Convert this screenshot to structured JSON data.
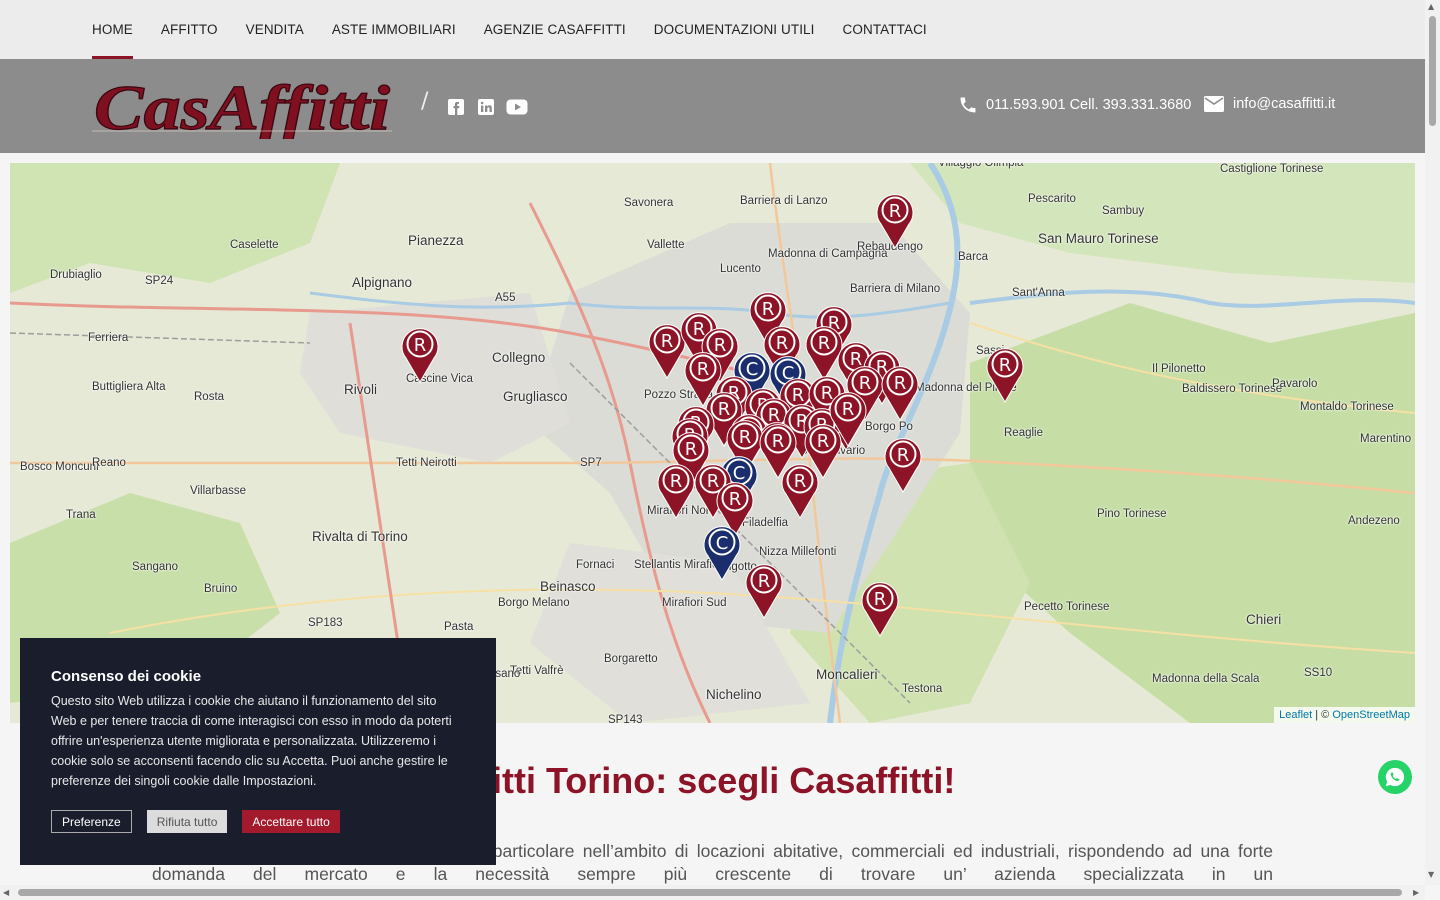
{
  "nav": {
    "items": [
      "HOME",
      "AFFITTO",
      "VENDITA",
      "ASTE IMMOBILIARI",
      "AGENZIE CASAFFITTI",
      "DOCUMENTAZIONI UTILI",
      "CONTATTACI"
    ],
    "active": "HOME"
  },
  "header": {
    "logo_text": "CasAffitti",
    "separator": "/",
    "phone": "011.593.901 Cell. 393.331.3680",
    "email": "info@casaffitti.it",
    "social_icons": [
      "facebook-icon",
      "linkedin-icon",
      "youtube-icon"
    ]
  },
  "map": {
    "places": [
      {
        "name": "Villaggio Olimpia"
      },
      {
        "name": "Castiglione Torinese"
      },
      {
        "name": "Barriera di Lanzo"
      },
      {
        "name": "Savonera"
      },
      {
        "name": "Pescarito"
      },
      {
        "name": "Sambuy"
      },
      {
        "name": "Pianezza"
      },
      {
        "name": "Vallette"
      },
      {
        "name": "Madonna di Campagna"
      },
      {
        "name": "Rebaudengo"
      },
      {
        "name": "Caselette"
      },
      {
        "name": "Lucento"
      },
      {
        "name": "Barca"
      },
      {
        "name": "San Mauro Torinese"
      },
      {
        "name": "Drubiaglio"
      },
      {
        "name": "SP24"
      },
      {
        "name": "Alpignano"
      },
      {
        "name": "Barriera di Milano"
      },
      {
        "name": "Sant'Anna"
      },
      {
        "name": "A55"
      },
      {
        "name": "Ferriera"
      },
      {
        "name": "Collegno"
      },
      {
        "name": "Sassi"
      },
      {
        "name": "Il Pilonetto"
      },
      {
        "name": "Cascine Vica"
      },
      {
        "name": "Rivoli"
      },
      {
        "name": "Grugliasco"
      },
      {
        "name": "Pozzo Strada"
      },
      {
        "name": "Madonna del Pilone"
      },
      {
        "name": "Baldissero Torinese"
      },
      {
        "name": "Pavarolo"
      },
      {
        "name": "Buttigliera Alta"
      },
      {
        "name": "Rosta"
      },
      {
        "name": "Montaldo Torinese"
      },
      {
        "name": "Borgo Po"
      },
      {
        "name": "Reaglie"
      },
      {
        "name": "Marentino"
      },
      {
        "name": "San Salvario"
      },
      {
        "name": "Bosco Moncuni"
      },
      {
        "name": "Reano"
      },
      {
        "name": "Tetti Neirotti"
      },
      {
        "name": "SP7"
      },
      {
        "name": "Villarbasse"
      },
      {
        "name": "Mirafiori Nord"
      },
      {
        "name": "Filadelfia"
      },
      {
        "name": "Pino Torinese"
      },
      {
        "name": "Andezeno"
      },
      {
        "name": "Trana"
      },
      {
        "name": "Rivalta di Torino"
      },
      {
        "name": "Nizza Millefonti"
      },
      {
        "name": "Sangano"
      },
      {
        "name": "Fornaci"
      },
      {
        "name": "Stellantis Mirafiori"
      },
      {
        "name": "Beinasco"
      },
      {
        "name": "Bruino"
      },
      {
        "name": "Borgo Melano"
      },
      {
        "name": "Mirafiori Sud"
      },
      {
        "name": "Pecetto Torinese"
      },
      {
        "name": "Chieri"
      },
      {
        "name": "SP183"
      },
      {
        "name": "Pasta"
      },
      {
        "name": "Borgaretto"
      },
      {
        "name": "Tetti Valfrè"
      },
      {
        "name": "Moncalieri"
      },
      {
        "name": "Testona"
      },
      {
        "name": "Nichelino"
      },
      {
        "name": "Madonna della Scala"
      },
      {
        "name": "SS10"
      },
      {
        "name": "SP143"
      },
      {
        "name": "Orbassano"
      },
      {
        "name": "Lingotto"
      }
    ],
    "attribution_leaflet": "Leaflet",
    "attribution_sep": " | © ",
    "attribution_osm": "OpenStreetMap"
  },
  "content": {
    "headline": "ffitti Torino: scegli Casaffitti!",
    "paragraph": "po delle intermediazioni immobiliari ed in particolare nell’ambito di locazioni abitative, commerciali ed industriali, rispondendo ad una forte domanda del mercato e la necessità sempre più crescente di trovare un’ azienda specializzata in un"
  },
  "cookie": {
    "title": "Consenso dei cookie",
    "text": "Questo sito Web utilizza i cookie che aiutano il funzionamento del sito Web e per tenere traccia di come interagisci con esso in modo da poterti offrire un'esperienza utente migliorata e personalizzata. Utilizzeremo i cookie solo se acconsenti facendo clic su Accetta. Puoi anche gestire le preferenze dei singoli cookie dalle Impostazioni.",
    "btn_pref": "Preferenze",
    "btn_reject": "Rifiuta tutto",
    "btn_accept": "Accettare tutto"
  },
  "colors": {
    "brand": "#8c1426",
    "pin_red": "#8c1426",
    "pin_blue": "#1a2e6e",
    "header_bg": "#8c8c8c",
    "whatsapp": "#25d366"
  }
}
